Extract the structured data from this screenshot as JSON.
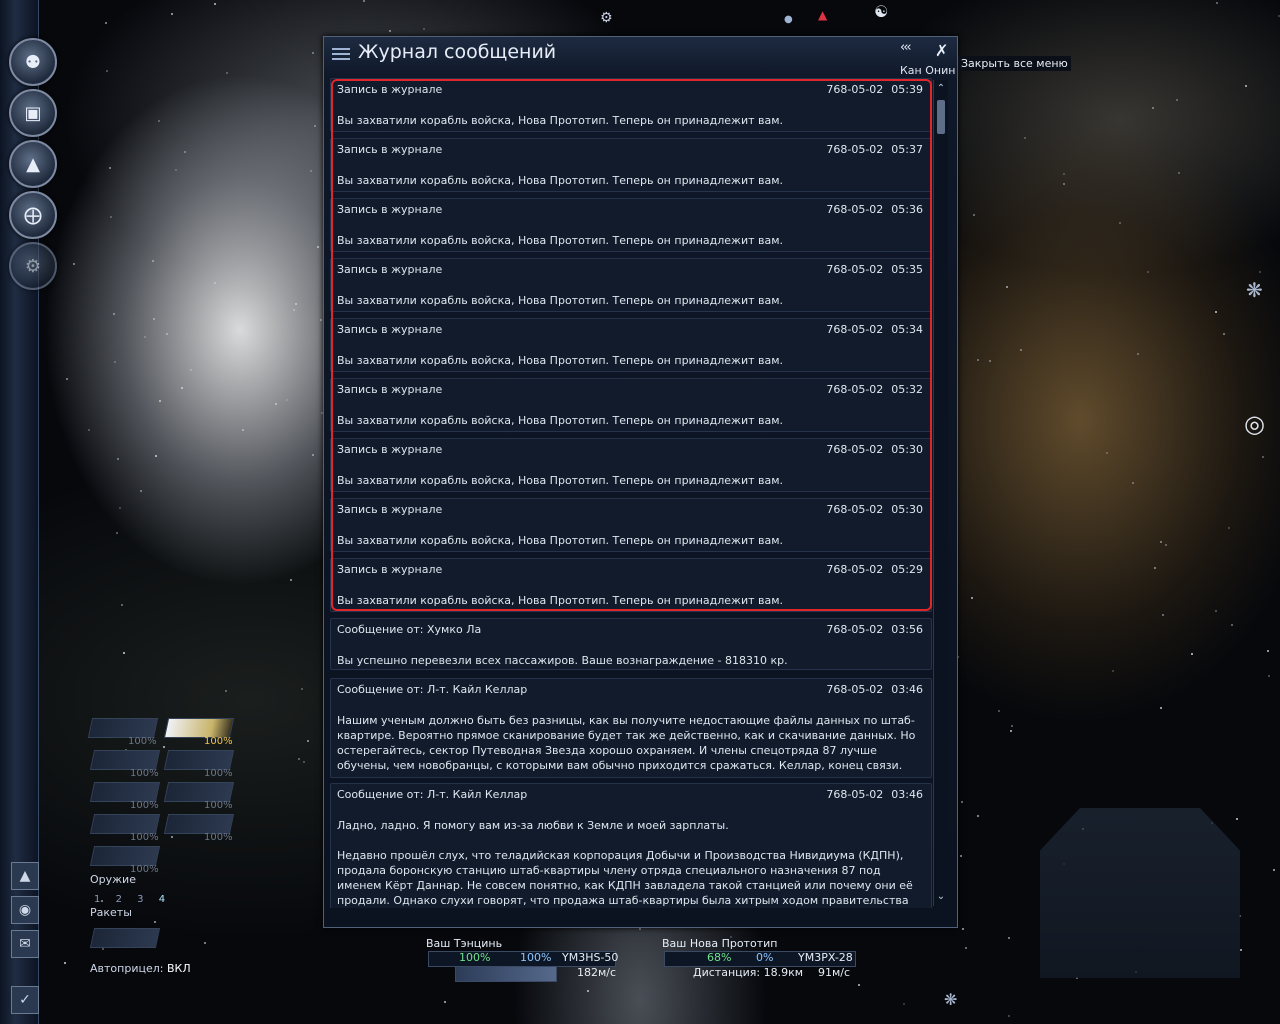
{
  "window": {
    "title": "Журнал сообщений",
    "pilot_name": "Кан Онин",
    "close_all_tooltip": "Закрыть все меню",
    "collapse_glyph": "‹‹‹"
  },
  "messages": [
    {
      "from": "Запись в журнале",
      "date": "768-05-02",
      "time": "05:39",
      "text": "Вы захватили корабль войска, Нова Прототип. Теперь он принадлежит вам."
    },
    {
      "from": "Запись в журнале",
      "date": "768-05-02",
      "time": "05:37",
      "text": "Вы захватили корабль войска, Нова Прототип. Теперь он принадлежит вам."
    },
    {
      "from": "Запись в журнале",
      "date": "768-05-02",
      "time": "05:36",
      "text": "Вы захватили корабль войска, Нова Прототип. Теперь он принадлежит вам."
    },
    {
      "from": "Запись в журнале",
      "date": "768-05-02",
      "time": "05:35",
      "text": "Вы захватили корабль войска, Нова Прототип. Теперь он принадлежит вам."
    },
    {
      "from": "Запись в журнале",
      "date": "768-05-02",
      "time": "05:34",
      "text": "Вы захватили корабль войска, Нова Прототип. Теперь он принадлежит вам."
    },
    {
      "from": "Запись в журнале",
      "date": "768-05-02",
      "time": "05:32",
      "text": "Вы захватили корабль войска, Нова Прототип. Теперь он принадлежит вам."
    },
    {
      "from": "Запись в журнале",
      "date": "768-05-02",
      "time": "05:30",
      "text": "Вы захватили корабль войска, Нова Прототип. Теперь он принадлежит вам."
    },
    {
      "from": "Запись в журнале",
      "date": "768-05-02",
      "time": "05:30",
      "text": "Вы захватили корабль войска, Нова Прототип. Теперь он принадлежит вам."
    },
    {
      "from": "Запись в журнале",
      "date": "768-05-02",
      "time": "05:29",
      "text": "Вы захватили корабль войска, Нова Прототип. Теперь он принадлежит вам."
    },
    {
      "from": "Сообщение от: Хумко Ла",
      "date": "768-05-02",
      "time": "03:56",
      "text": "Вы успешно перевезли всех пассажиров. Ваше вознаграждение - 818310 кр."
    },
    {
      "from": "Сообщение от: Л-т. Кайл Келлар",
      "date": "768-05-02",
      "time": "03:46",
      "text": "Нашим ученым должно быть без разницы, как вы получите недостающие файлы данных по штаб-квартире. Вероятно прямое сканирование будет так же действенно, как и скачивание данных. Но остерегайтесь, сектор Путеводная Звезда хорошо охраняем. И члены спецотряда 87 лучше обучены, чем новобранцы, с которыми вам обычно приходится сражаться. Келлар, конец связи."
    },
    {
      "from": "Сообщение от: Л-т. Кайл Келлар",
      "date": "768-05-02",
      "time": "03:46",
      "text": "Ладно, ладно. Я помогу вам из-за любви к Земле и моей зарплаты.",
      "text2": "Недавно прошёл слух, что теладийская корпорация Добычи и Производства Нивидиума (КДПН), продала боронскую станцию штаб-квартиры члену отряда специального назначения 87 под именем Кёрт Даннар. Не совсем понятно, как КДПН завладела такой станцией или почему они её продали. Однако слухи говорят, что продажа штаб-квартиры была хитрым ходом правительства Теладов как помощь Аргону в Земной войне. К"
    }
  ],
  "weapons": {
    "slots": [
      {
        "pct": "100%",
        "active": false
      },
      {
        "pct": "100%",
        "active": true
      },
      {
        "pct": "100%",
        "active": false
      },
      {
        "pct": "100%",
        "active": false
      },
      {
        "pct": "100%",
        "active": false
      },
      {
        "pct": "100%",
        "active": false
      },
      {
        "pct": "100%",
        "active": false
      },
      {
        "pct": "100%",
        "active": false
      },
      {
        "pct": "100%",
        "active": false
      }
    ],
    "label": "Оружие",
    "groups": [
      "1",
      "2",
      "3",
      "4"
    ],
    "missiles_label": "Ракеты",
    "autoaim_label": "Автоприцел:",
    "autoaim_value": "ВКЛ"
  },
  "hud": {
    "own_ship": {
      "name": "Ваш Тэнцинь",
      "hull": "100%",
      "shield": "100%",
      "code": "YM3HS-50",
      "speed": "182м/с"
    },
    "target": {
      "name": "Ваш Нова Прототип",
      "hull": "68%",
      "shield": "0%",
      "code": "YM3PX-28",
      "distance_label": "Дистанция: 18.9км",
      "speed": "91м/с"
    }
  },
  "colors": {
    "highlight": "#e0262a",
    "panel": "#0f1829",
    "hull_green": "#6fe08a",
    "shield_blue": "#8cc4ff"
  }
}
